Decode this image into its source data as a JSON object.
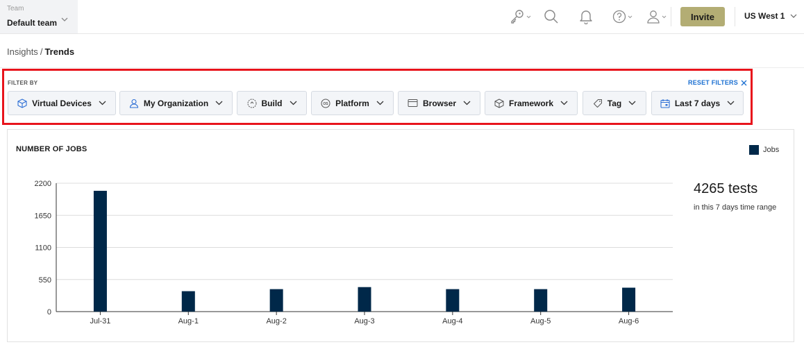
{
  "topbar": {
    "team_label": "Team",
    "team_name": "Default team",
    "invite_label": "Invite",
    "region_label": "US West 1",
    "icons": [
      "key-icon",
      "search-icon",
      "bell-icon",
      "help-icon",
      "user-icon"
    ]
  },
  "breadcrumb": {
    "parent": "Insights",
    "separator": "/",
    "current": "Trends"
  },
  "filters": {
    "heading": "FILTER BY",
    "reset_label": "RESET FILTERS",
    "chips": [
      {
        "label": "Virtual Devices",
        "icon": "cube-icon"
      },
      {
        "label": "My Organization",
        "icon": "user-icon"
      },
      {
        "label": "Build",
        "icon": "build-icon"
      },
      {
        "label": "Platform",
        "icon": "os-icon"
      },
      {
        "label": "Browser",
        "icon": "browser-icon"
      },
      {
        "label": "Framework",
        "icon": "box-icon"
      },
      {
        "label": "Tag",
        "icon": "tag-icon"
      },
      {
        "label": "Last 7 days",
        "icon": "calendar-icon"
      }
    ]
  },
  "card": {
    "title": "NUMBER OF JOBS",
    "summary_count": "4265 tests",
    "summary_sub": "in this 7 days time range"
  },
  "chart_data": {
    "type": "bar",
    "categories": [
      "Jul-31",
      "Aug-1",
      "Aug-2",
      "Aug-3",
      "Aug-4",
      "Aug-5",
      "Aug-6"
    ],
    "series": [
      {
        "name": "Jobs",
        "values": [
          2070,
          350,
          385,
          420,
          385,
          385,
          410
        ],
        "color": "#002849"
      }
    ],
    "yticks": [
      0,
      550,
      1100,
      1650,
      2200
    ],
    "ylim": [
      0,
      2200
    ],
    "grid": true,
    "legend": "top-right"
  }
}
